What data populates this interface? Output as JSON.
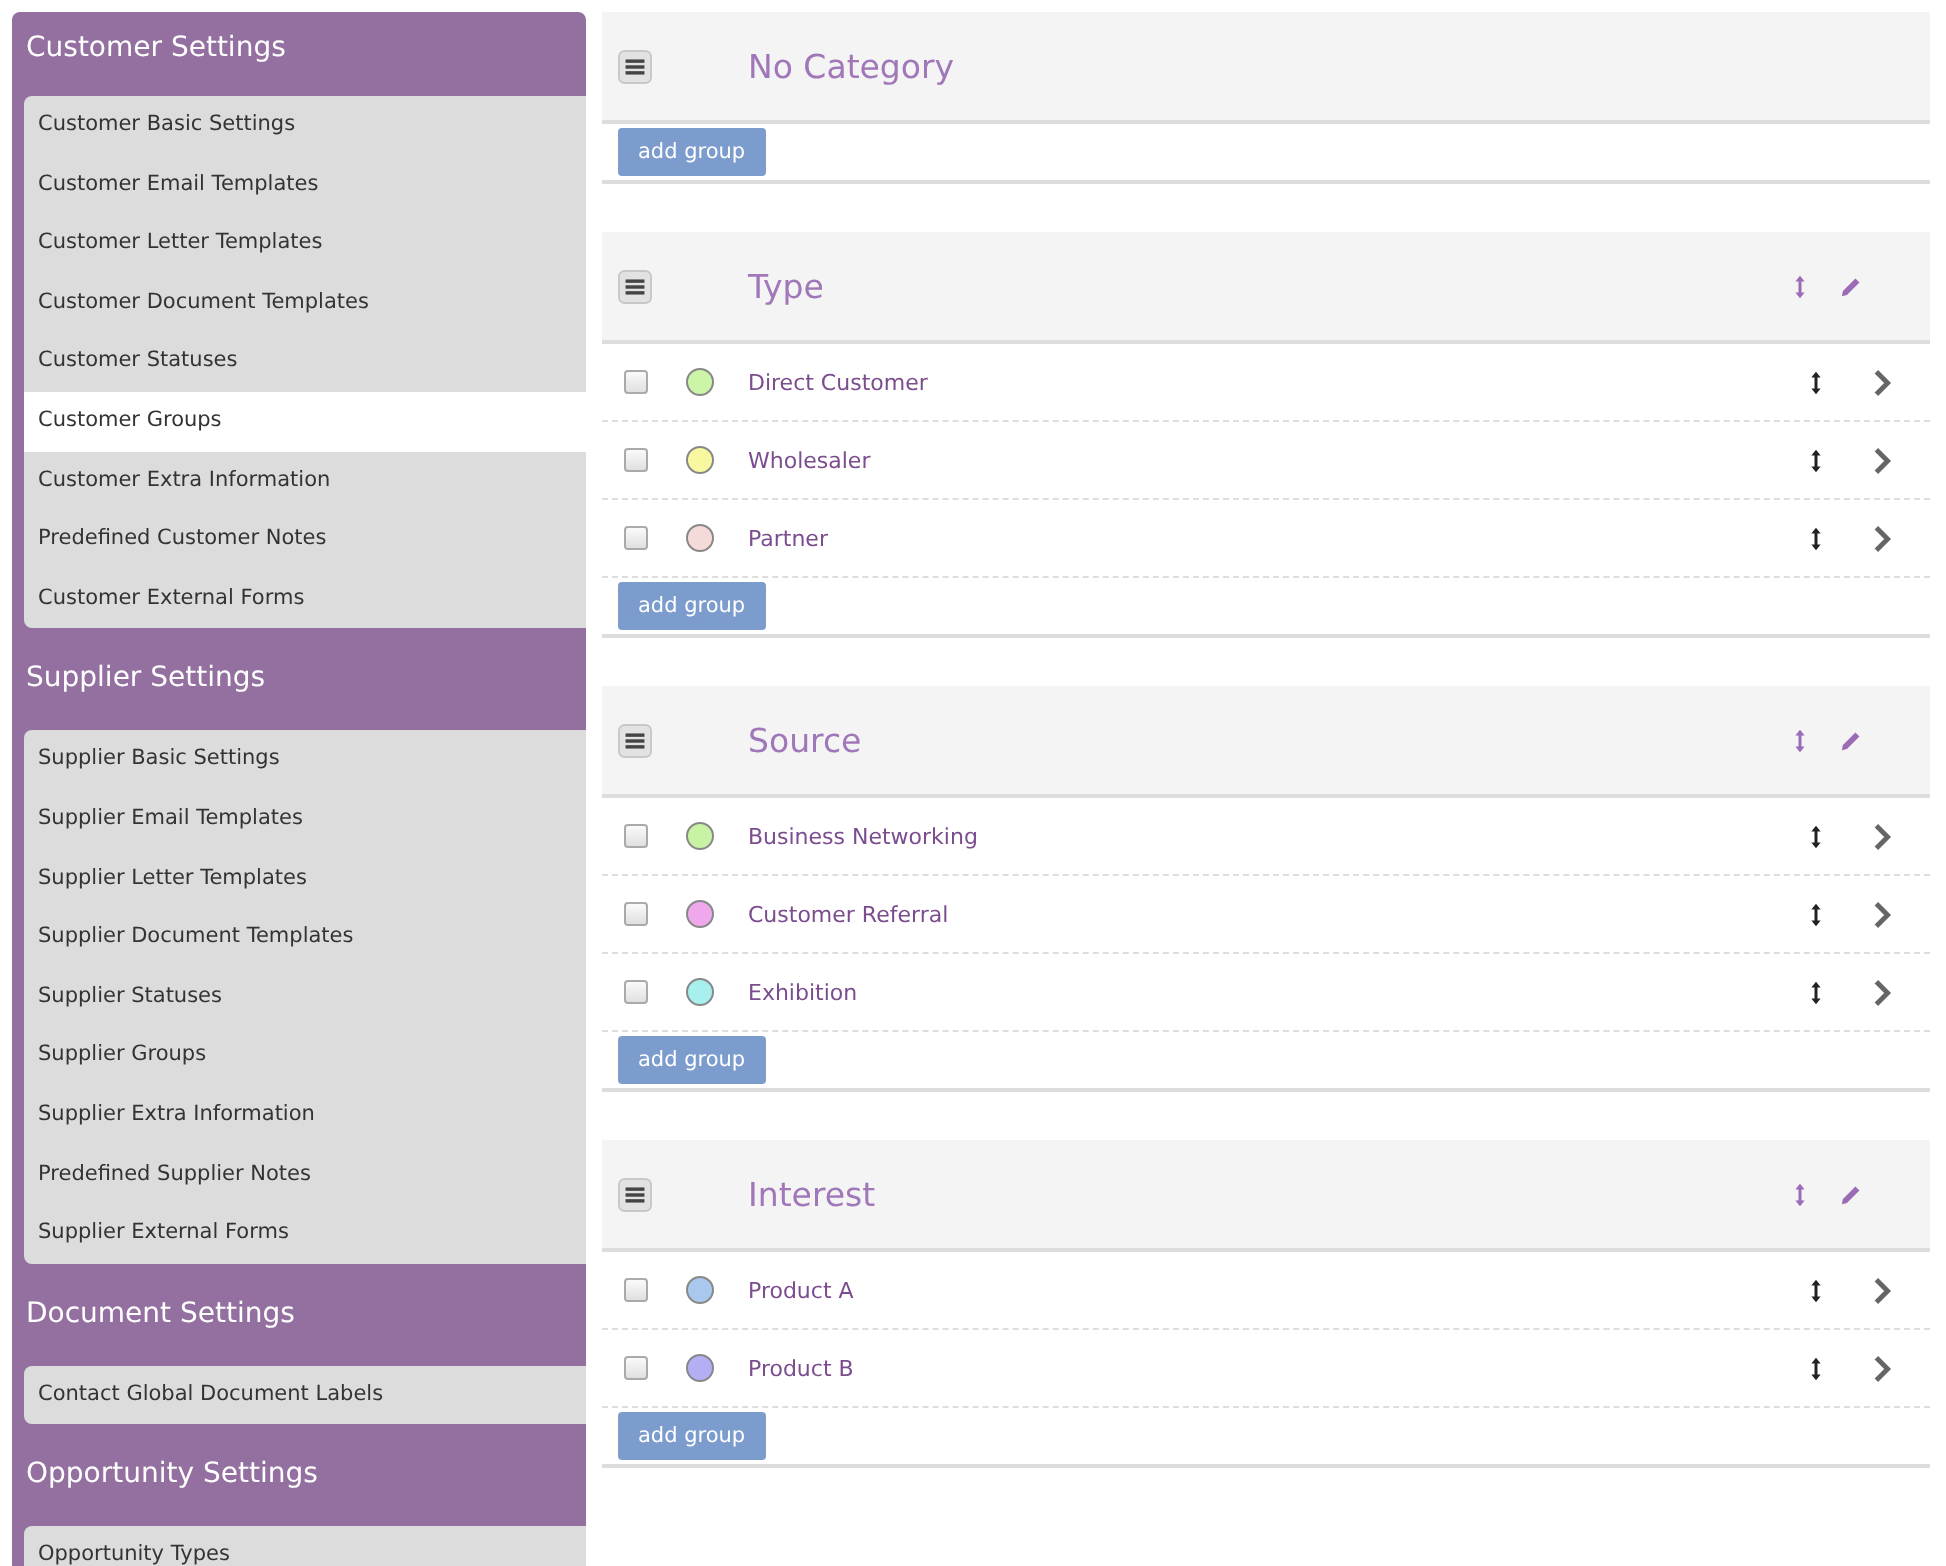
{
  "sidebar": {
    "sections": [
      {
        "title": "Customer Settings",
        "items": [
          {
            "label": "Customer Basic Settings",
            "selected": false
          },
          {
            "label": "Customer Email Templates",
            "selected": false
          },
          {
            "label": "Customer Letter Templates",
            "selected": false
          },
          {
            "label": "Customer Document Templates",
            "selected": false
          },
          {
            "label": "Customer Statuses",
            "selected": false
          },
          {
            "label": "Customer Groups",
            "selected": true
          },
          {
            "label": "Customer Extra Information",
            "selected": false
          },
          {
            "label": "Predefined Customer Notes",
            "selected": false
          },
          {
            "label": "Customer External Forms",
            "selected": false
          }
        ]
      },
      {
        "title": "Supplier Settings",
        "items": [
          {
            "label": "Supplier Basic Settings",
            "selected": false
          },
          {
            "label": "Supplier Email Templates",
            "selected": false
          },
          {
            "label": "Supplier Letter Templates",
            "selected": false
          },
          {
            "label": "Supplier Document Templates",
            "selected": false
          },
          {
            "label": "Supplier Statuses",
            "selected": false
          },
          {
            "label": "Supplier Groups",
            "selected": false
          },
          {
            "label": "Supplier Extra Information",
            "selected": false
          },
          {
            "label": "Predefined Supplier Notes",
            "selected": false
          },
          {
            "label": "Supplier External Forms",
            "selected": false
          }
        ]
      },
      {
        "title": "Document Settings",
        "items": [
          {
            "label": "Contact Global Document Labels",
            "selected": false
          }
        ]
      },
      {
        "title": "Opportunity Settings",
        "items": [
          {
            "label": "Opportunity Types",
            "selected": false
          }
        ]
      }
    ]
  },
  "categories": [
    {
      "kind": "uncategorized",
      "title": "No Category",
      "button": "add group"
    },
    {
      "kind": "category",
      "title": "Type",
      "groups": [
        {
          "name": "Direct Customer",
          "checked": false,
          "color": "#ccf5a8"
        },
        {
          "name": "Wholesaler",
          "checked": false,
          "color": "#f8f8a0"
        },
        {
          "name": "Partner",
          "checked": false,
          "color": "#f5dada"
        }
      ],
      "button": "add group"
    },
    {
      "kind": "category",
      "title": "Source",
      "groups": [
        {
          "name": "Business Networking",
          "checked": false,
          "color": "#c8f2a4"
        },
        {
          "name": "Customer Referral",
          "checked": false,
          "color": "#f0a8ec"
        },
        {
          "name": "Exhibition",
          "checked": false,
          "color": "#a8f0ee"
        }
      ],
      "button": "add group"
    },
    {
      "kind": "category",
      "title": "Interest",
      "groups": [
        {
          "name": "Product A",
          "checked": false,
          "color": "#a8c8ee"
        },
        {
          "name": "Product B",
          "checked": false,
          "color": "#b4aef5"
        }
      ],
      "button": "add group"
    }
  ]
}
